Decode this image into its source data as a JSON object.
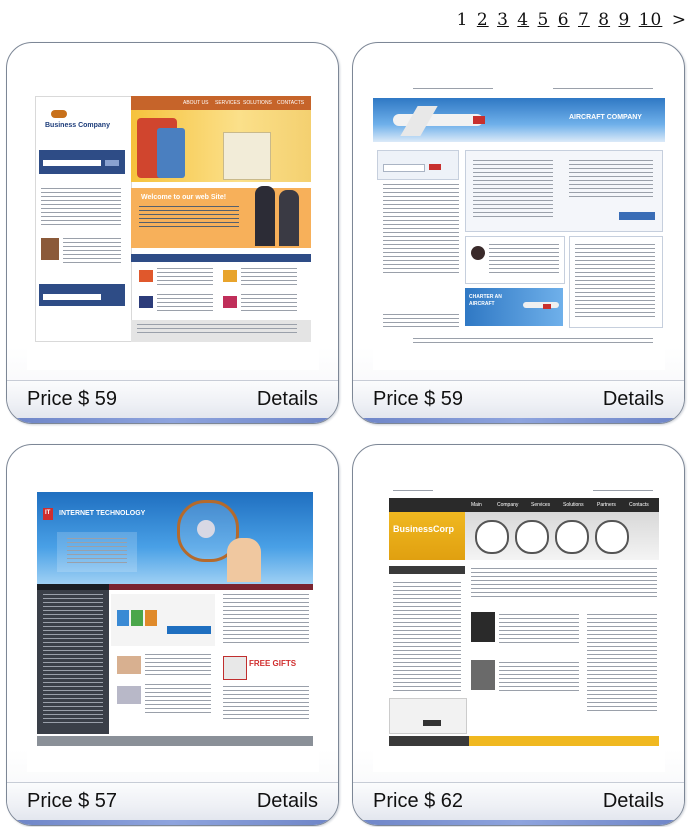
{
  "pagination": {
    "pages": [
      "1",
      "2",
      "3",
      "4",
      "5",
      "6",
      "7",
      "8",
      "9",
      "10"
    ],
    "current": "1",
    "next": ">"
  },
  "templates": [
    {
      "price": "Price $ 59",
      "details": "Details",
      "thumb": {
        "brand": "Business Company",
        "nav": [
          "ABOUT US",
          "SERVICES",
          "SOLUTIONS",
          "CONTACTS"
        ],
        "welcome": "Welcome to our web Site!"
      }
    },
    {
      "price": "Price $ 59",
      "details": "Details",
      "thumb": {
        "brand": "AIRCRAFT COMPANY",
        "promo": "CHARTER AN AIRCRAFT"
      }
    },
    {
      "price": "Price $ 57",
      "details": "Details",
      "thumb": {
        "brand": "INTERNET TECHNOLOGY",
        "logo": "IT",
        "gifts": "FREE GIFTS"
      }
    },
    {
      "price": "Price $ 62",
      "details": "Details",
      "thumb": {
        "brand": "BusinessCorp",
        "nav": [
          "Main",
          "Company",
          "Services",
          "Solutions",
          "Partners",
          "Contacts"
        ]
      }
    }
  ]
}
